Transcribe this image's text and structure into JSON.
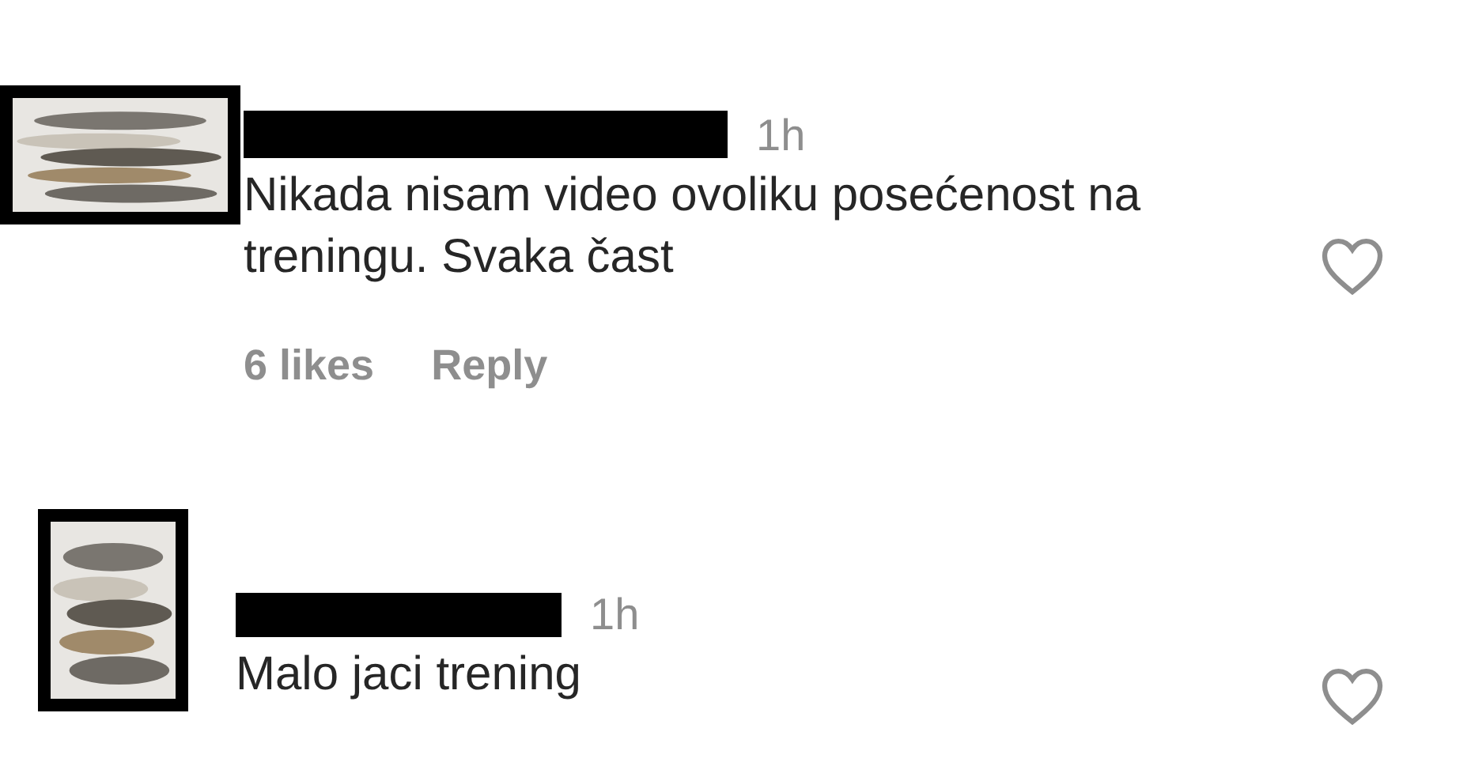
{
  "comments": [
    {
      "time": "1h",
      "text": "Nikada nisam video ovoliku posećenost na treningu. Svaka čast",
      "liked": false,
      "likes": "6 likes",
      "reply": "Reply"
    },
    {
      "time": "1h",
      "text": "Malo jaci trening",
      "liked": false
    }
  ]
}
